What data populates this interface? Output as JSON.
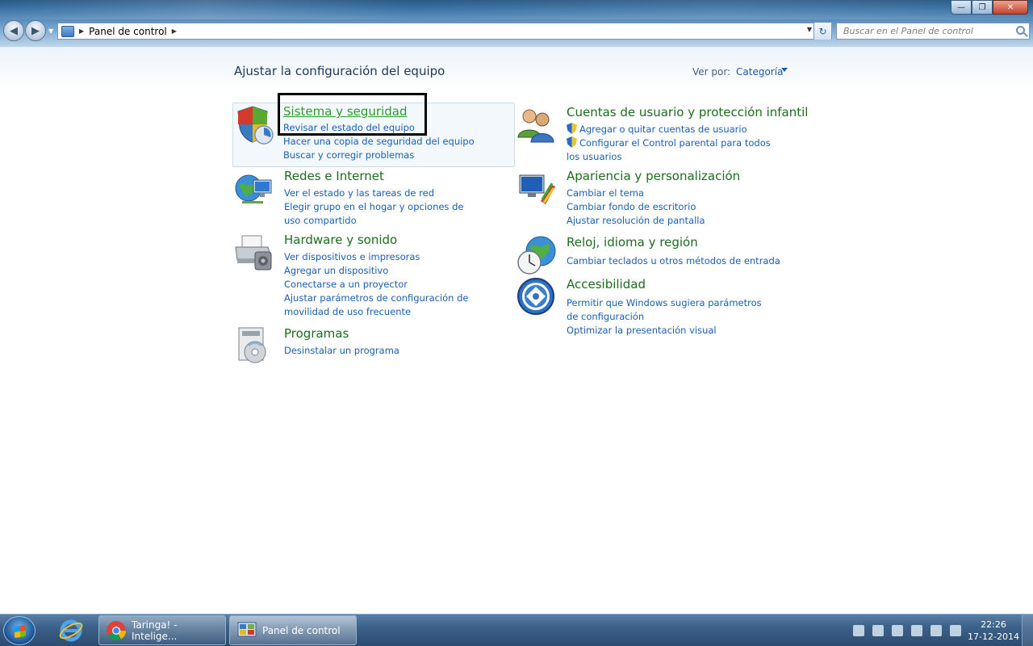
{
  "addressbar": {
    "path": "Panel de control"
  },
  "search": {
    "placeholder": "Buscar en el Panel de control"
  },
  "header": {
    "title": "Ajustar la configuración del equipo",
    "viewby_label": "Ver por:",
    "viewby_value": "Categoría"
  },
  "categories": [
    {
      "title": "Sistema y seguridad",
      "icon": "shield-icon",
      "links": [
        "Revisar el estado del equipo",
        "Hacer una copia de seguridad del equipo",
        "Buscar y corregir problemas"
      ]
    },
    {
      "title": "Redes e Internet",
      "icon": "network-globe-icon",
      "links": [
        "Ver el estado y las tareas de red",
        "Elegir grupo en el hogar y opciones de uso compartido"
      ]
    },
    {
      "title": "Hardware y sonido",
      "icon": "printer-icon",
      "links": [
        "Ver dispositivos e impresoras",
        "Agregar un dispositivo",
        "Conectarse a un proyector",
        "Ajustar parámetros de configuración de movilidad de uso frecuente"
      ]
    },
    {
      "title": "Programas",
      "icon": "programs-disc-icon",
      "links": [
        "Desinstalar un programa"
      ]
    },
    {
      "title": "Cuentas de usuario y protección infantil",
      "icon": "users-icon",
      "links": [
        "Agregar o quitar cuentas de usuario",
        "Configurar el Control parental para todos los usuarios"
      ]
    },
    {
      "title": "Apariencia y personalización",
      "icon": "monitor-paint-icon",
      "links": [
        "Cambiar el tema",
        "Cambiar fondo de escritorio",
        "Ajustar resolución de pantalla"
      ]
    },
    {
      "title": "Reloj, idioma y región",
      "icon": "clock-globe-icon",
      "links": [
        "Cambiar teclados u otros métodos de entrada"
      ]
    },
    {
      "title": "Accesibilidad",
      "icon": "accessibility-icon",
      "links": [
        "Permitir que Windows sugiera parámetros de configuración",
        "Optimizar la presentación visual"
      ]
    }
  ],
  "taskbar": {
    "tasks": [
      {
        "label": "Taringa! - Intelige...",
        "icon": "chrome-icon"
      },
      {
        "label": "Panel de control",
        "icon": "control-panel-icon"
      }
    ],
    "time": "22:26",
    "date": "17-12-2014"
  },
  "colors": {
    "category_title": "#1c6c1c",
    "link": "#1a5fb4",
    "taskbar": "#3c6189"
  }
}
